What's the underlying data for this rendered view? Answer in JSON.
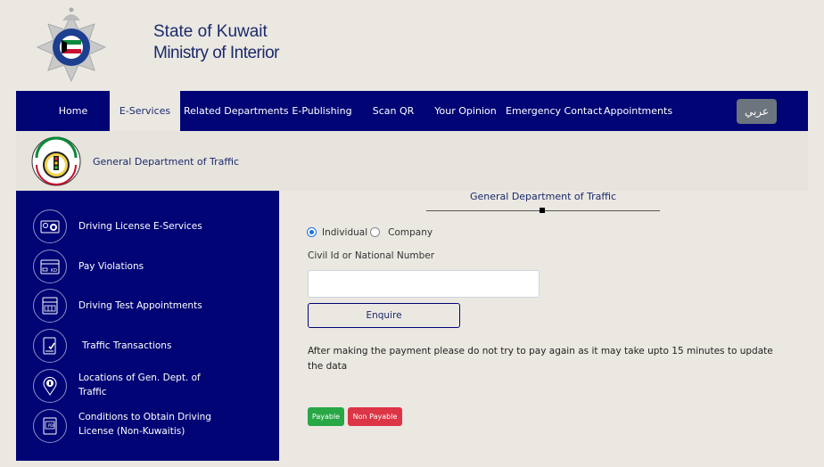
{
  "header": {
    "logo_icon": "kuwait-police-emblem",
    "title_line1": "State of Kuwait",
    "title_line2": "Ministry of Interior"
  },
  "nav": {
    "items": [
      {
        "label": "Home",
        "active": false
      },
      {
        "label": "E-Services",
        "active": true
      },
      {
        "label": "Related Departments",
        "active": false
      },
      {
        "label": "E-Publishing",
        "active": false
      },
      {
        "label": "Scan QR",
        "active": false
      },
      {
        "label": "Your Opinion",
        "active": false
      },
      {
        "label": "Emergency Contact",
        "active": false
      },
      {
        "label": "Appointments",
        "active": false
      }
    ],
    "language_button": "عربي"
  },
  "department": {
    "logo_icon": "traffic-department-emblem",
    "title": "General Department of Traffic"
  },
  "sidebar": {
    "items": [
      {
        "label": "Driving License E-Services",
        "icon": "license-card-icon"
      },
      {
        "label": "Pay Violations",
        "icon": "kd-card-icon"
      },
      {
        "label": "Driving Test Appointments",
        "icon": "calendar-icon"
      },
      {
        "label": "Traffic Transactions",
        "icon": "document-check-icon"
      },
      {
        "label": "Locations of Gen. Dept. of Traffic",
        "icon": "location-pin-icon"
      },
      {
        "label": "Conditions to Obtain Driving License (Non-Kuwaitis)",
        "icon": "pdf-document-icon"
      }
    ]
  },
  "main": {
    "title": "General Department of Traffic",
    "radio_options": [
      {
        "label": "Individual",
        "checked": true
      },
      {
        "label": "Company",
        "checked": false
      }
    ],
    "civil_id_label": "Civil Id or National Number",
    "civil_id_value": "",
    "civil_id_placeholder": "",
    "enquire_button": "Enquire",
    "notice": "After making the payment please do not try to pay again as it may take upto 15 minutes to update the data",
    "legend": {
      "payable": "Payable",
      "non_payable": "Non Payable",
      "payable_color": "#28a745",
      "non_payable_color": "#dc3545"
    }
  },
  "colors": {
    "primary": "#000475",
    "background": "#ebe8e2",
    "language_button": "#6c757d"
  }
}
